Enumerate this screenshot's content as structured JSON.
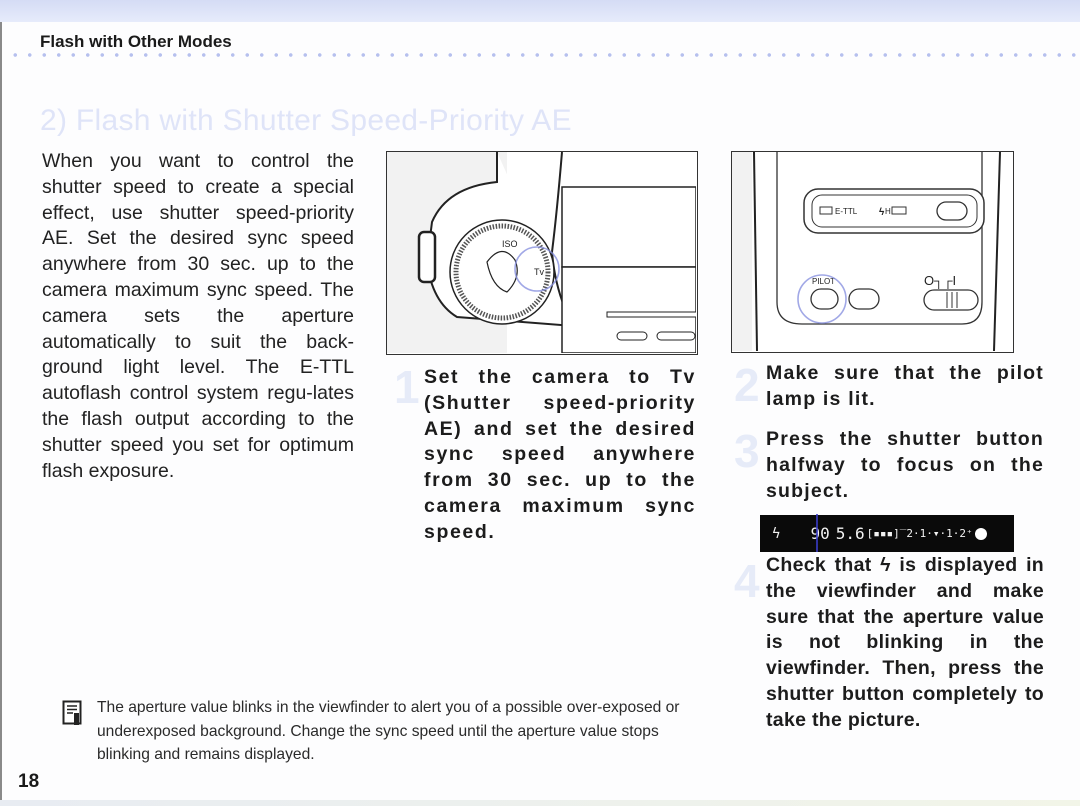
{
  "header": {
    "title": "Flash with Other Modes"
  },
  "section": {
    "title": "2) Flash with Shutter Speed-Priority AE"
  },
  "intro": "When you want to control the shutter speed to create a special effect, use shutter speed-priority AE. Set the desired sync speed anywhere from 30 sec. up to the camera maximum sync speed. The camera sets the aperture automatically to suit the back-ground light level. The E-TTL autoflash control system regu-lates the flash output according to the shutter speed you set for optimum flash exposure.",
  "figures": {
    "camera_dial": {
      "label": "Tv",
      "icon": "mode-dial-icon"
    },
    "flash_panel": {
      "labels": {
        "ettl": "E-TTL",
        "high_speed": "H",
        "pilot": "PILOT",
        "switch": "O┐┌I"
      }
    }
  },
  "steps": [
    {
      "number": "1",
      "text": "Set the camera to Tv (Shutter speed-priority AE) and set the desired sync speed anywhere from 30 sec. up to the camera maximum sync speed."
    },
    {
      "number": "2",
      "text": "Make sure that the pilot lamp is lit."
    },
    {
      "number": "3",
      "text": "Press the shutter button halfway to focus on the subject."
    },
    {
      "number": "4",
      "text": "Check that ϟ is displayed in the viewfinder and make sure that the aperture value is not blinking in the viewfinder. Then, press the shutter button completely to take the picture."
    }
  ],
  "viewfinder": {
    "flash": "ϟ",
    "shutter": "90",
    "aperture": "5.6",
    "meter": "[▪▪▪]‾2·1·▾·1·2⁺"
  },
  "note": "The aperture value blinks in the viewfinder to alert you of a possible over-exposed or underexposed background.  Change the sync speed until the aperture value stops blinking and remains displayed.",
  "page_number": "18"
}
